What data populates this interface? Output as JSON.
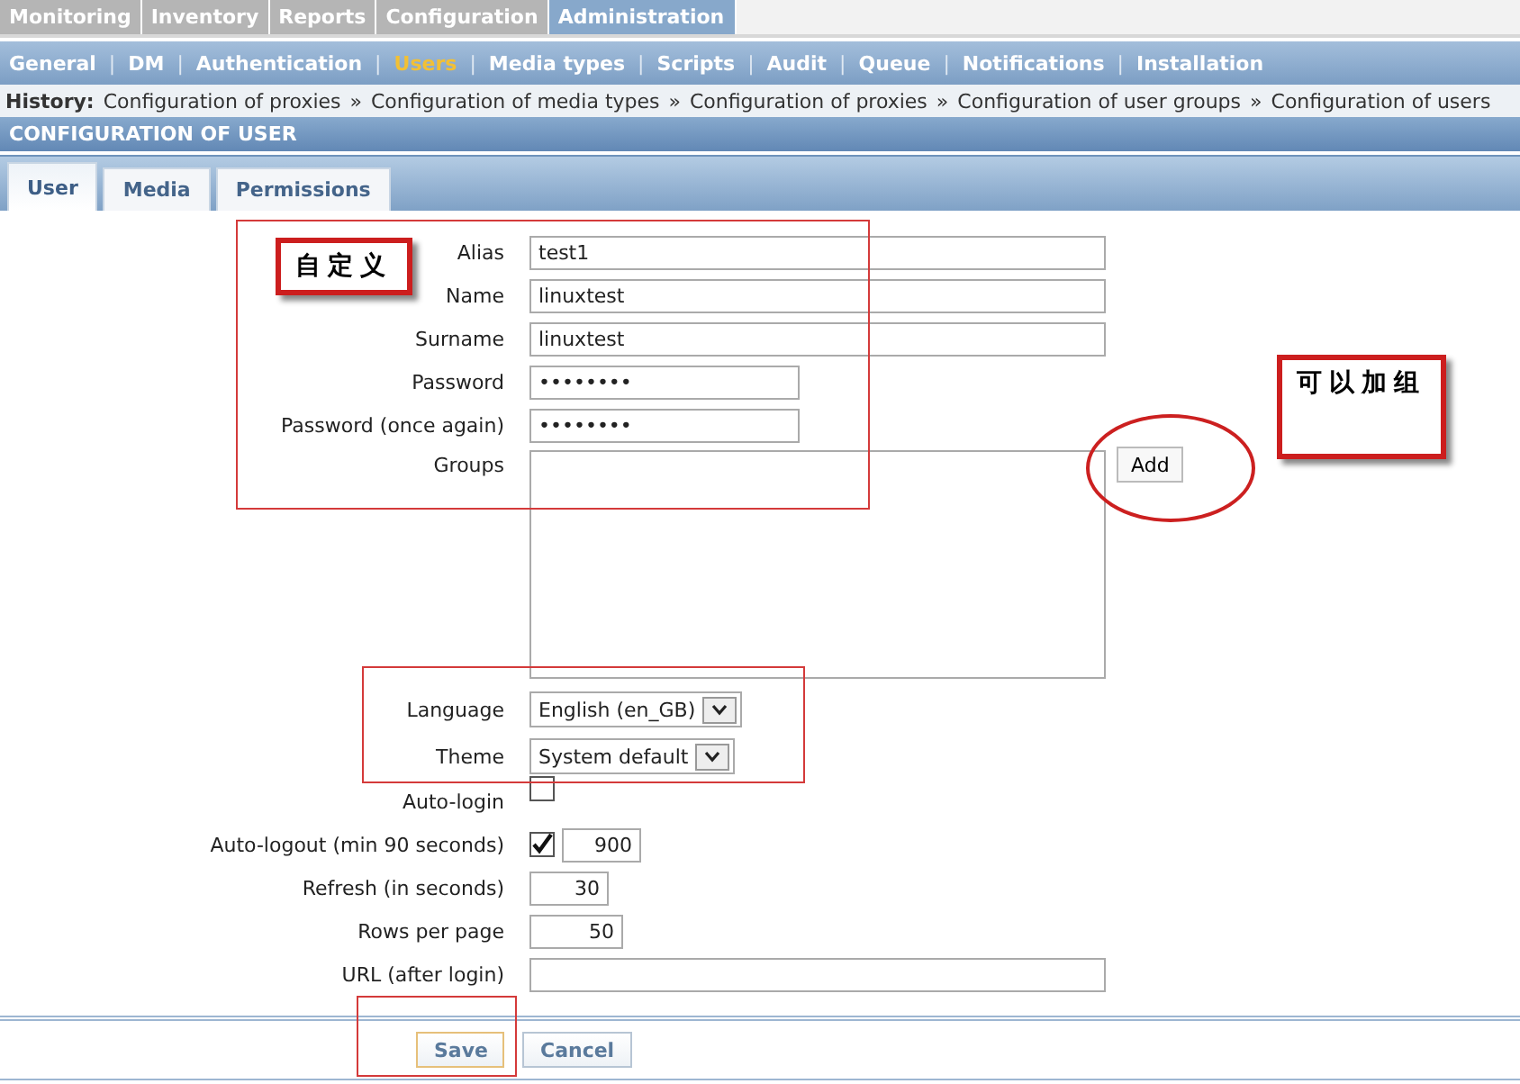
{
  "main_menu": [
    {
      "label": "Monitoring",
      "selected": false
    },
    {
      "label": "Inventory",
      "selected": false
    },
    {
      "label": "Reports",
      "selected": false
    },
    {
      "label": "Configuration",
      "selected": false
    },
    {
      "label": "Administration",
      "selected": true
    }
  ],
  "sub_menu": {
    "separator": "|",
    "items": [
      {
        "label": "General",
        "selected": false
      },
      {
        "label": "DM",
        "selected": false
      },
      {
        "label": "Authentication",
        "selected": false
      },
      {
        "label": "Users",
        "selected": true
      },
      {
        "label": "Media types",
        "selected": false
      },
      {
        "label": "Scripts",
        "selected": false
      },
      {
        "label": "Audit",
        "selected": false
      },
      {
        "label": "Queue",
        "selected": false
      },
      {
        "label": "Notifications",
        "selected": false
      },
      {
        "label": "Installation",
        "selected": false
      }
    ]
  },
  "history": {
    "label": "History:",
    "separator": "»",
    "items": [
      "Configuration of proxies",
      "Configuration of media types",
      "Configuration of proxies",
      "Configuration of user groups",
      "Configuration of users"
    ]
  },
  "page_title": "CONFIGURATION OF USER",
  "tabs": [
    {
      "label": "User",
      "selected": true
    },
    {
      "label": "Media",
      "selected": false
    },
    {
      "label": "Permissions",
      "selected": false
    }
  ],
  "form": {
    "fields": [
      {
        "kind": "text",
        "label": "Alias",
        "value": "test1"
      },
      {
        "kind": "text",
        "label": "Name",
        "value": "linuxtest"
      },
      {
        "kind": "text",
        "label": "Surname",
        "value": "linuxtest"
      },
      {
        "kind": "password",
        "label": "Password",
        "value": "••••••••"
      },
      {
        "kind": "password",
        "label": "Password (once again)",
        "value": "••••••••"
      },
      {
        "kind": "list",
        "label": "Groups",
        "button": "Add"
      },
      {
        "kind": "select",
        "label": "Language",
        "value": "English (en_GB)"
      },
      {
        "kind": "select",
        "label": "Theme",
        "value": "System default"
      },
      {
        "kind": "checkbox",
        "label": "Auto-login",
        "checked": false
      },
      {
        "kind": "checkbox_number",
        "label": "Auto-logout (min 90 seconds)",
        "checked": true,
        "value": "900"
      },
      {
        "kind": "number",
        "label": "Refresh (in seconds)",
        "value": "30"
      },
      {
        "kind": "number",
        "label": "Rows per page",
        "value": "50"
      },
      {
        "kind": "text",
        "label": "URL (after login)"
      }
    ]
  },
  "buttons": [
    {
      "label": "Save",
      "kind": "primary"
    },
    {
      "label": "Cancel",
      "kind": "secondary"
    }
  ],
  "annotations": [
    {
      "kind": "rect"
    },
    {
      "kind": "note",
      "text": "自定义"
    },
    {
      "kind": "rect"
    },
    {
      "kind": "note",
      "text": "可以加组"
    },
    {
      "kind": "ellipse"
    },
    {
      "kind": "rect"
    }
  ]
}
